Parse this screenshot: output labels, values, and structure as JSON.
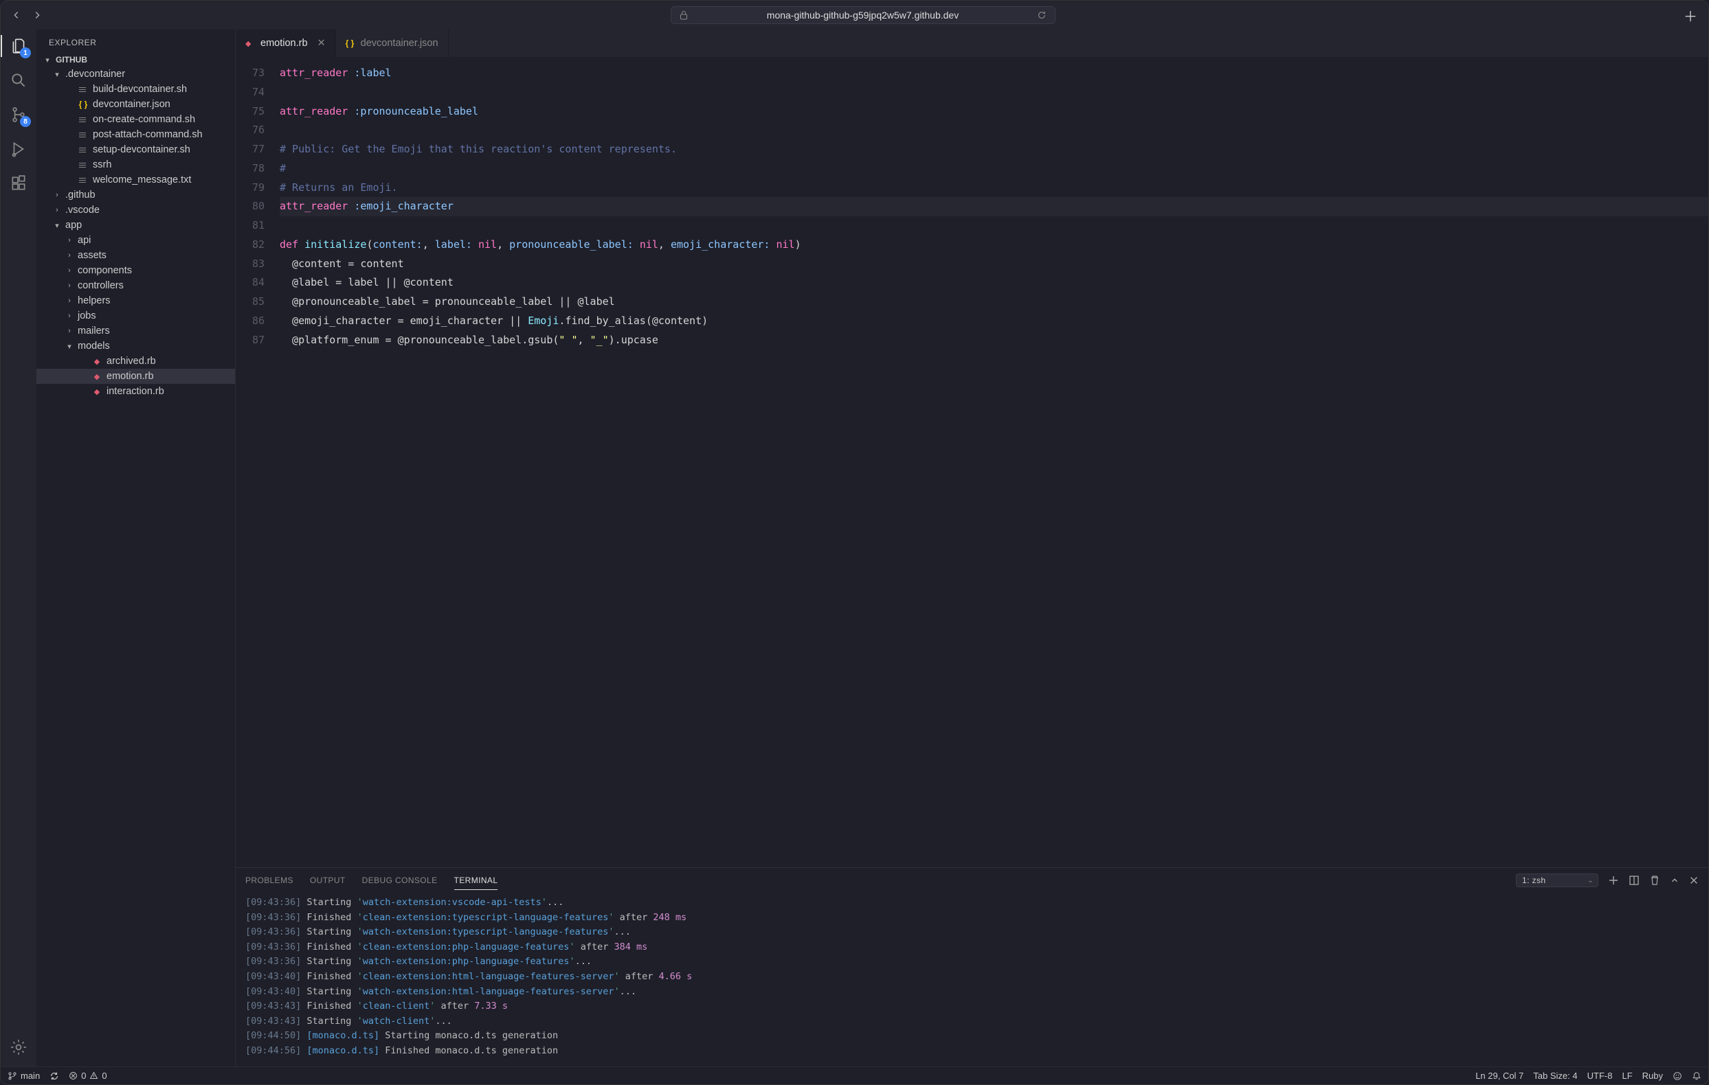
{
  "titleBar": {
    "url": "mona-github-github-g59jpq2w5w7.github.dev"
  },
  "activityBar": {
    "explorerBadge": "1",
    "scmBadge": "8"
  },
  "sidebar": {
    "title": "EXPLORER",
    "sectionLabel": "GITHUB",
    "tree": [
      {
        "kind": "section",
        "indent": 0,
        "label": "GITHUB"
      },
      {
        "kind": "folder-open",
        "indent": 1,
        "label": ".devcontainer"
      },
      {
        "kind": "file-sh",
        "indent": 2,
        "label": "build-devcontainer.sh"
      },
      {
        "kind": "file-json",
        "indent": 2,
        "label": "devcontainer.json"
      },
      {
        "kind": "file-sh",
        "indent": 2,
        "label": "on-create-command.sh"
      },
      {
        "kind": "file-sh",
        "indent": 2,
        "label": "post-attach-command.sh"
      },
      {
        "kind": "file-sh",
        "indent": 2,
        "label": "setup-devcontainer.sh"
      },
      {
        "kind": "file-sh",
        "indent": 2,
        "label": "ssrh"
      },
      {
        "kind": "file-sh",
        "indent": 2,
        "label": "welcome_message.txt"
      },
      {
        "kind": "folder-closed",
        "indent": 1,
        "label": ".github"
      },
      {
        "kind": "folder-closed",
        "indent": 1,
        "label": ".vscode"
      },
      {
        "kind": "folder-open",
        "indent": 1,
        "label": "app"
      },
      {
        "kind": "folder-closed",
        "indent": 2,
        "label": "api"
      },
      {
        "kind": "folder-closed",
        "indent": 2,
        "label": "assets"
      },
      {
        "kind": "folder-closed",
        "indent": 2,
        "label": "components"
      },
      {
        "kind": "folder-closed",
        "indent": 2,
        "label": "controllers"
      },
      {
        "kind": "folder-closed",
        "indent": 2,
        "label": "helpers"
      },
      {
        "kind": "folder-closed",
        "indent": 2,
        "label": "jobs"
      },
      {
        "kind": "folder-closed",
        "indent": 2,
        "label": "mailers"
      },
      {
        "kind": "folder-open",
        "indent": 2,
        "label": "models"
      },
      {
        "kind": "file-rb",
        "indent": 3,
        "label": "archived.rb"
      },
      {
        "kind": "file-rb",
        "indent": 3,
        "label": "emotion.rb",
        "selected": true
      },
      {
        "kind": "file-rb",
        "indent": 3,
        "label": "interaction.rb"
      }
    ]
  },
  "editor": {
    "tabs": [
      {
        "icon": "ruby",
        "label": "emotion.rb",
        "active": true,
        "closable": true
      },
      {
        "icon": "json",
        "label": "devcontainer.json",
        "active": false,
        "closable": false
      }
    ],
    "firstLine": 73,
    "highlightLine": 80,
    "lines": [
      [
        {
          "c": "kw",
          "t": "attr_reader"
        },
        {
          "c": "",
          "t": " "
        },
        {
          "c": "sym",
          "t": ":label"
        }
      ],
      [],
      [
        {
          "c": "kw",
          "t": "attr_reader"
        },
        {
          "c": "",
          "t": " "
        },
        {
          "c": "sym",
          "t": ":pronounceable_label"
        }
      ],
      [],
      [
        {
          "c": "cmt",
          "t": "# Public: Get the Emoji that this reaction's content represents."
        }
      ],
      [
        {
          "c": "cmt",
          "t": "#"
        }
      ],
      [
        {
          "c": "cmt",
          "t": "# Returns an Emoji."
        }
      ],
      [
        {
          "c": "kw",
          "t": "attr_reader"
        },
        {
          "c": "",
          "t": " "
        },
        {
          "c": "sym",
          "t": ":emoji_character"
        }
      ],
      [],
      [
        {
          "c": "kw",
          "t": "def"
        },
        {
          "c": "",
          "t": " "
        },
        {
          "c": "fn",
          "t": "initialize"
        },
        {
          "c": "",
          "t": "("
        },
        {
          "c": "sym",
          "t": "content:"
        },
        {
          "c": "",
          "t": ", "
        },
        {
          "c": "sym",
          "t": "label:"
        },
        {
          "c": "",
          "t": " "
        },
        {
          "c": "kw",
          "t": "nil"
        },
        {
          "c": "",
          "t": ", "
        },
        {
          "c": "sym",
          "t": "pronounceable_label:"
        },
        {
          "c": "",
          "t": " "
        },
        {
          "c": "kw",
          "t": "nil"
        },
        {
          "c": "",
          "t": ", "
        },
        {
          "c": "sym",
          "t": "emoji_character:"
        },
        {
          "c": "",
          "t": " "
        },
        {
          "c": "kw",
          "t": "nil"
        },
        {
          "c": "",
          "t": ")"
        }
      ],
      [
        {
          "c": "",
          "t": "  @content = content"
        }
      ],
      [
        {
          "c": "",
          "t": "  @label = label || @content"
        }
      ],
      [
        {
          "c": "",
          "t": "  @pronounceable_label = pronounceable_label || @label"
        }
      ],
      [
        {
          "c": "",
          "t": "  @emoji_character = emoji_character || "
        },
        {
          "c": "const",
          "t": "Emoji"
        },
        {
          "c": "",
          "t": ".find_by_alias(@content)"
        }
      ],
      [
        {
          "c": "",
          "t": "  @platform_enum = @pronounceable_label.gsub("
        },
        {
          "c": "str",
          "t": "\" \""
        },
        {
          "c": "",
          "t": ", "
        },
        {
          "c": "str",
          "t": "\"_\""
        },
        {
          "c": "",
          "t": ").upcase"
        }
      ]
    ]
  },
  "panel": {
    "tabs": [
      "PROBLEMS",
      "OUTPUT",
      "DEBUG CONSOLE",
      "TERMINAL"
    ],
    "activeTab": "TERMINAL",
    "shell": "1: zsh",
    "terminalLines": [
      [
        {
          "c": "ts",
          "t": "[09:43:36]"
        },
        {
          "c": "plain",
          "t": " Starting "
        },
        {
          "c": "qgreen",
          "t": "'"
        },
        {
          "c": "task1",
          "t": "watch-extension:vscode-api-tests"
        },
        {
          "c": "qgreen",
          "t": "'"
        },
        {
          "c": "plain",
          "t": "..."
        }
      ],
      [
        {
          "c": "ts",
          "t": "[09:43:36]"
        },
        {
          "c": "plain",
          "t": " Finished "
        },
        {
          "c": "qgreen",
          "t": "'"
        },
        {
          "c": "task1",
          "t": "clean-extension:typescript-language-features"
        },
        {
          "c": "qgreen",
          "t": "'"
        },
        {
          "c": "plain",
          "t": " after "
        },
        {
          "c": "num1",
          "t": "248 ms"
        }
      ],
      [
        {
          "c": "ts",
          "t": "[09:43:36]"
        },
        {
          "c": "plain",
          "t": " Starting "
        },
        {
          "c": "qgreen",
          "t": "'"
        },
        {
          "c": "task1",
          "t": "watch-extension:typescript-language-features"
        },
        {
          "c": "qgreen",
          "t": "'"
        },
        {
          "c": "plain",
          "t": "..."
        }
      ],
      [
        {
          "c": "ts",
          "t": "[09:43:36]"
        },
        {
          "c": "plain",
          "t": " Finished "
        },
        {
          "c": "qgreen",
          "t": "'"
        },
        {
          "c": "task1",
          "t": "clean-extension:php-language-features"
        },
        {
          "c": "qgreen",
          "t": "'"
        },
        {
          "c": "plain",
          "t": " after "
        },
        {
          "c": "num1",
          "t": "384 ms"
        }
      ],
      [
        {
          "c": "ts",
          "t": "[09:43:36]"
        },
        {
          "c": "plain",
          "t": " Starting "
        },
        {
          "c": "qgreen",
          "t": "'"
        },
        {
          "c": "task1",
          "t": "watch-extension:php-language-features"
        },
        {
          "c": "qgreen",
          "t": "'"
        },
        {
          "c": "plain",
          "t": "..."
        }
      ],
      [
        {
          "c": "ts",
          "t": "[09:43:40]"
        },
        {
          "c": "plain",
          "t": " Finished "
        },
        {
          "c": "qgreen",
          "t": "'"
        },
        {
          "c": "task1",
          "t": "clean-extension:html-language-features-server"
        },
        {
          "c": "qgreen",
          "t": "'"
        },
        {
          "c": "plain",
          "t": " after "
        },
        {
          "c": "num1",
          "t": "4.66 s"
        }
      ],
      [
        {
          "c": "ts",
          "t": "[09:43:40]"
        },
        {
          "c": "plain",
          "t": " Starting "
        },
        {
          "c": "qgreen",
          "t": "'"
        },
        {
          "c": "task1",
          "t": "watch-extension:html-language-features-server"
        },
        {
          "c": "qgreen",
          "t": "'"
        },
        {
          "c": "plain",
          "t": "..."
        }
      ],
      [
        {
          "c": "ts",
          "t": "[09:43:43]"
        },
        {
          "c": "plain",
          "t": " Finished "
        },
        {
          "c": "qgreen",
          "t": "'"
        },
        {
          "c": "task1",
          "t": "clean-client"
        },
        {
          "c": "qgreen",
          "t": "'"
        },
        {
          "c": "plain",
          "t": " after "
        },
        {
          "c": "num1",
          "t": "7.33 s"
        }
      ],
      [
        {
          "c": "ts",
          "t": "[09:43:43]"
        },
        {
          "c": "plain",
          "t": " Starting "
        },
        {
          "c": "qgreen",
          "t": "'"
        },
        {
          "c": "task1",
          "t": "watch-client"
        },
        {
          "c": "qgreen",
          "t": "'"
        },
        {
          "c": "plain",
          "t": "..."
        }
      ],
      [
        {
          "c": "ts",
          "t": "[09:44:50]"
        },
        {
          "c": "plain",
          "t": " "
        },
        {
          "c": "tag",
          "t": "[monaco.d.ts]"
        },
        {
          "c": "plain",
          "t": " Starting monaco.d.ts generation"
        }
      ],
      [
        {
          "c": "ts",
          "t": "[09:44:56]"
        },
        {
          "c": "plain",
          "t": " "
        },
        {
          "c": "tag",
          "t": "[monaco.d.ts]"
        },
        {
          "c": "plain",
          "t": " Finished monaco.d.ts generation"
        }
      ]
    ]
  },
  "statusBar": {
    "branch": "main",
    "errors": "0",
    "warnings": "0",
    "lineCol": "Ln 29, Col 7",
    "tabSize": "Tab Size: 4",
    "encoding": "UTF-8",
    "eol": "LF",
    "language": "Ruby"
  }
}
